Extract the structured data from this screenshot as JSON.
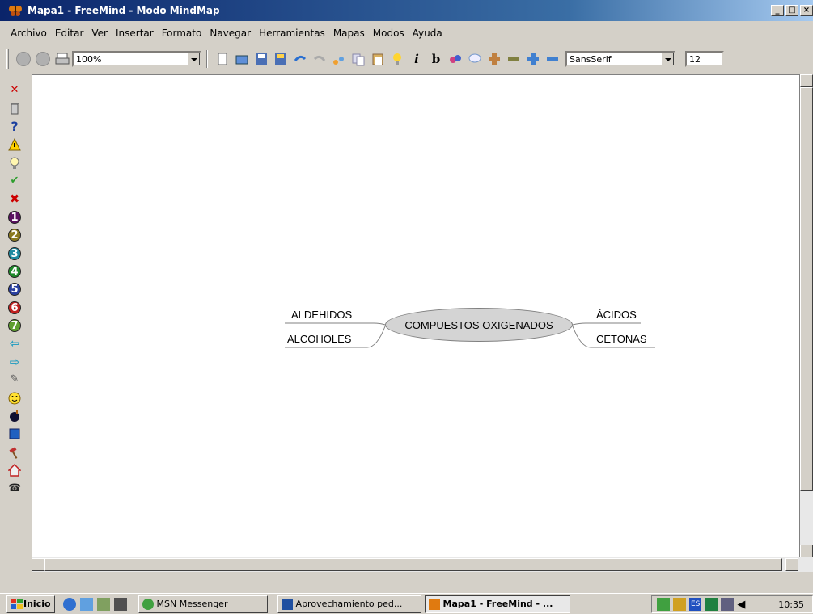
{
  "window": {
    "title": "Mapa1 - FreeMind - Modo MindMap",
    "minimize": "_",
    "maximize": "□",
    "close": "×"
  },
  "menu": [
    "Archivo",
    "Editar",
    "Ver",
    "Insertar",
    "Formato",
    "Navegar",
    "Herramientas",
    "Mapas",
    "Modos",
    "Ayuda"
  ],
  "toolbar": {
    "zoom": "100%",
    "font_family": "SansSerif",
    "font_size": "12",
    "italic": "i",
    "bold": "b"
  },
  "mindmap": {
    "root": "COMPUESTOS OXIGENADOS",
    "left_nodes": [
      "ALDEHIDOS",
      "ALCOHOLES"
    ],
    "right_nodes": [
      "ÁCIDOS",
      "CETONAS"
    ]
  },
  "icons": {
    "side": [
      "close-red-icon",
      "trash-icon",
      "question-icon",
      "warning-icon",
      "lightbulb-icon",
      "check-icon",
      "cross-icon",
      "number-1-icon",
      "number-2-icon",
      "number-3-icon",
      "number-4-icon",
      "number-5-icon",
      "number-6-icon",
      "number-7-icon",
      "arrow-left-icon",
      "arrow-right-icon",
      "paperclip-icon",
      "smiley-icon",
      "bomb-icon",
      "book-icon",
      "hammer-icon",
      "home-icon",
      "phone-icon"
    ],
    "side_numbers": [
      "1",
      "2",
      "3",
      "4",
      "5",
      "6",
      "7"
    ]
  },
  "taskbar": {
    "start": "Inicio",
    "tasks": [
      "MSN Messenger",
      "Aprovechamiento ped...",
      "Mapa1 - FreeMind - ..."
    ],
    "tray_lang": "ES",
    "clock": "10:35"
  },
  "colors": {
    "titlebar_start": "#0a246a",
    "titlebar_end": "#a6caf0",
    "root_node_fill": "#d4d4d4",
    "accent_red": "#cc0000",
    "accent_green": "#2e9e2e"
  }
}
